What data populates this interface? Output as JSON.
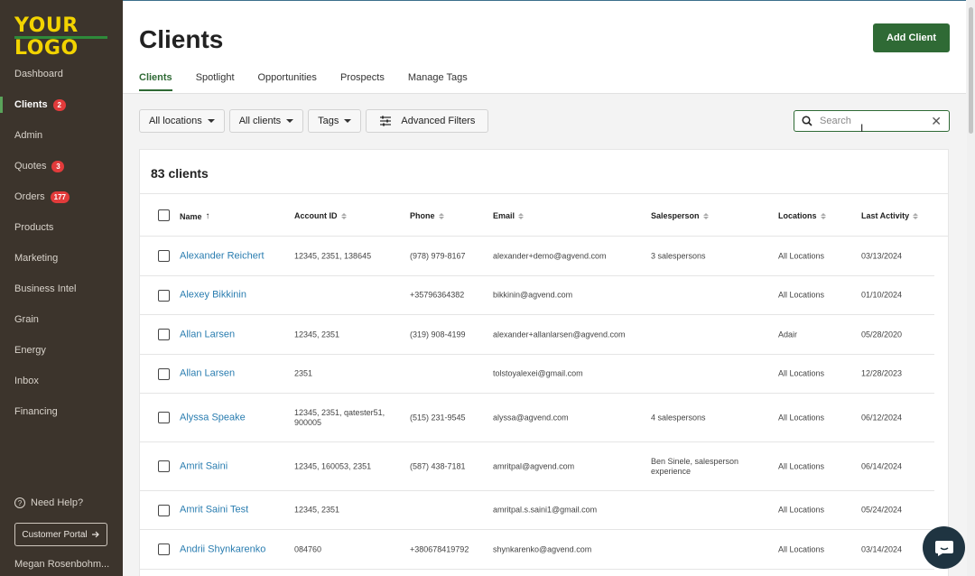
{
  "sidebar": {
    "logo": "YOUR LOGO",
    "items": [
      {
        "label": "Dashboard",
        "badge": null,
        "active": false
      },
      {
        "label": "Clients",
        "badge": "2",
        "active": true
      },
      {
        "label": "Admin",
        "badge": null,
        "active": false
      },
      {
        "label": "Quotes",
        "badge": "3",
        "active": false
      },
      {
        "label": "Orders",
        "badge": "177",
        "active": false
      },
      {
        "label": "Products",
        "badge": null,
        "active": false
      },
      {
        "label": "Marketing",
        "badge": null,
        "active": false
      },
      {
        "label": "Business Intel",
        "badge": null,
        "active": false
      },
      {
        "label": "Grain",
        "badge": null,
        "active": false
      },
      {
        "label": "Energy",
        "badge": null,
        "active": false
      },
      {
        "label": "Inbox",
        "badge": null,
        "active": false
      },
      {
        "label": "Financing",
        "badge": null,
        "active": false
      }
    ],
    "help_label": "Need Help?",
    "portal_label": "Customer Portal",
    "user_name": "Megan Rosenbohm..."
  },
  "header": {
    "title": "Clients",
    "add_button": "Add Client",
    "tabs": [
      {
        "label": "Clients",
        "active": true
      },
      {
        "label": "Spotlight",
        "active": false
      },
      {
        "label": "Opportunities",
        "active": false
      },
      {
        "label": "Prospects",
        "active": false
      },
      {
        "label": "Manage Tags",
        "active": false
      }
    ]
  },
  "filters": {
    "locations": "All locations",
    "clients": "All clients",
    "tags": "Tags",
    "advanced": "Advanced Filters",
    "search_placeholder": "Search"
  },
  "table": {
    "count_label": "83 clients",
    "columns": [
      "Name",
      "Account ID",
      "Phone",
      "Email",
      "Salesperson",
      "Locations",
      "Last Activity"
    ],
    "rows": [
      {
        "name": "Alexander Reichert",
        "account": "12345, 2351, 138645",
        "phone": "(978) 979-8167",
        "email": "alexander+demo@agvend.com",
        "salesperson": "3 salespersons",
        "locations": "All Locations",
        "activity": "03/13/2024"
      },
      {
        "name": "Alexey Bikkinin",
        "account": "",
        "phone": "+35796364382",
        "email": "bikkinin@agvend.com",
        "salesperson": "",
        "locations": "All Locations",
        "activity": "01/10/2024"
      },
      {
        "name": "Allan Larsen",
        "account": "12345, 2351",
        "phone": "(319) 908-4199",
        "email": "alexander+allanlarsen@agvend.com",
        "salesperson": "",
        "locations": "Adair",
        "activity": "05/28/2020"
      },
      {
        "name": "Allan Larsen",
        "account": "2351",
        "phone": "",
        "email": "tolstoyalexei@gmail.com",
        "salesperson": "",
        "locations": "All Locations",
        "activity": "12/28/2023"
      },
      {
        "name": "Alyssa Speake",
        "account": "12345, 2351, qatester51, 900005",
        "phone": "(515) 231-9545",
        "email": "alyssa@agvend.com",
        "salesperson": "4 salespersons",
        "locations": "All Locations",
        "activity": "06/12/2024"
      },
      {
        "name": "Amrit Saini",
        "account": "12345, 160053, 2351",
        "phone": "(587) 438-7181",
        "email": "amritpal@agvend.com",
        "salesperson": "Ben Sinele, salesperson experience",
        "locations": "All Locations",
        "activity": "06/14/2024"
      },
      {
        "name": "Amrit Saini Test",
        "account": "12345, 2351",
        "phone": "",
        "email": "amritpal.s.saini1@gmail.com",
        "salesperson": "",
        "locations": "All Locations",
        "activity": "05/24/2024"
      },
      {
        "name": "Andrii Shynkarenko",
        "account": "084760",
        "phone": "+380678419792",
        "email": "shynkarenko@agvend.com",
        "salesperson": "",
        "locations": "All Locations",
        "activity": "03/14/2024"
      }
    ]
  }
}
